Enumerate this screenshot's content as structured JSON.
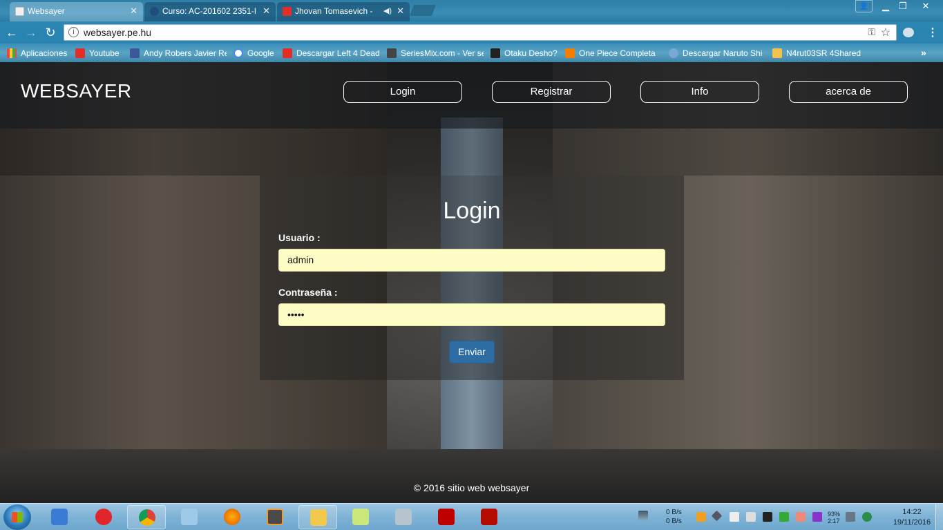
{
  "browser": {
    "tabs": [
      {
        "title": "Websayer",
        "active": true
      },
      {
        "title": "Curso: AC-201602 2351-I",
        "active": false
      },
      {
        "title": "Jhovan Tomasevich -",
        "active": false
      }
    ],
    "url": "websayer.pe.hu",
    "bookmarks": [
      "Aplicaciones",
      "Youtube",
      "Andy Robers Javier Re",
      "Google",
      "Descargar Left 4 Dead",
      "SeriesMix.com - Ver se",
      "Otaku Desho?",
      "One Piece Completa",
      "Descargar Naruto Shi",
      "N4rut03SR 4Shared"
    ]
  },
  "site": {
    "brand": "WEBSAYER",
    "nav": [
      "Login",
      "Registrar",
      "Info",
      "acerca de"
    ],
    "login": {
      "title": "Login",
      "user_label": "Usuario :",
      "user_value": "admin",
      "pass_label": "Contraseña :",
      "pass_value": "•••••",
      "submit": "Enviar"
    },
    "footer": "© 2016 sitio web websayer"
  },
  "taskbar": {
    "net_up": "0 B/s",
    "net_down": "0 B/s",
    "battery": "93%",
    "battery_time": "2:17",
    "time": "14:22",
    "date": "19/11/2016"
  },
  "colors": {
    "input_bg": "#fcfcc4",
    "button_bg": "#2e6da4",
    "chrome_blue": "#2b86b3"
  }
}
